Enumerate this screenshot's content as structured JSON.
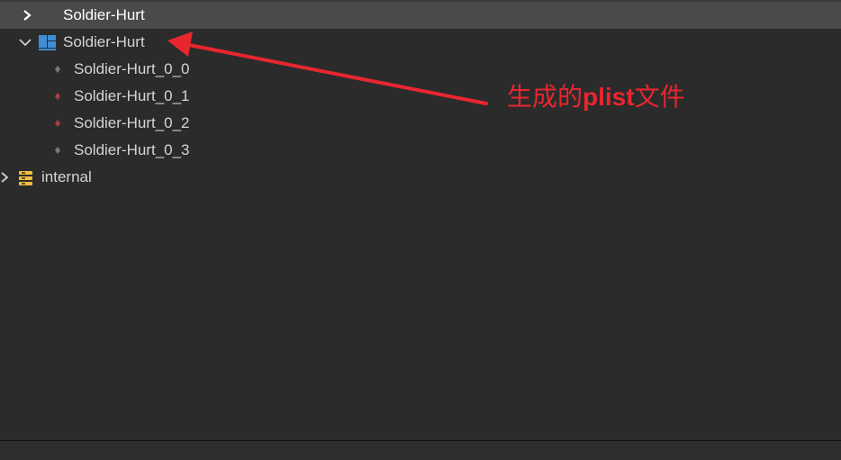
{
  "tree": {
    "header_label": "Soldier-Hurt",
    "atlas_label": "Soldier-Hurt",
    "frames": [
      {
        "label": "Soldier-Hurt_0_0",
        "dot_color": "#7a7a7a"
      },
      {
        "label": "Soldier-Hurt_0_1",
        "dot_color": "#a84040"
      },
      {
        "label": "Soldier-Hurt_0_2",
        "dot_color": "#a84040"
      },
      {
        "label": "Soldier-Hurt_0_3",
        "dot_color": "#7a7a7a"
      }
    ],
    "internal_label": "internal"
  },
  "annotation": {
    "text_prefix": "生成的",
    "text_bold": "plist",
    "text_suffix": "文件",
    "color": "#e8262f"
  },
  "icons": {
    "header": "chevron-right-icon",
    "atlas_toggle": "chevron-down-icon",
    "atlas": "sprite-atlas-icon",
    "frame": "sprite-frame-icon",
    "internal_toggle": "chevron-right-icon",
    "internal": "database-folder-icon"
  }
}
